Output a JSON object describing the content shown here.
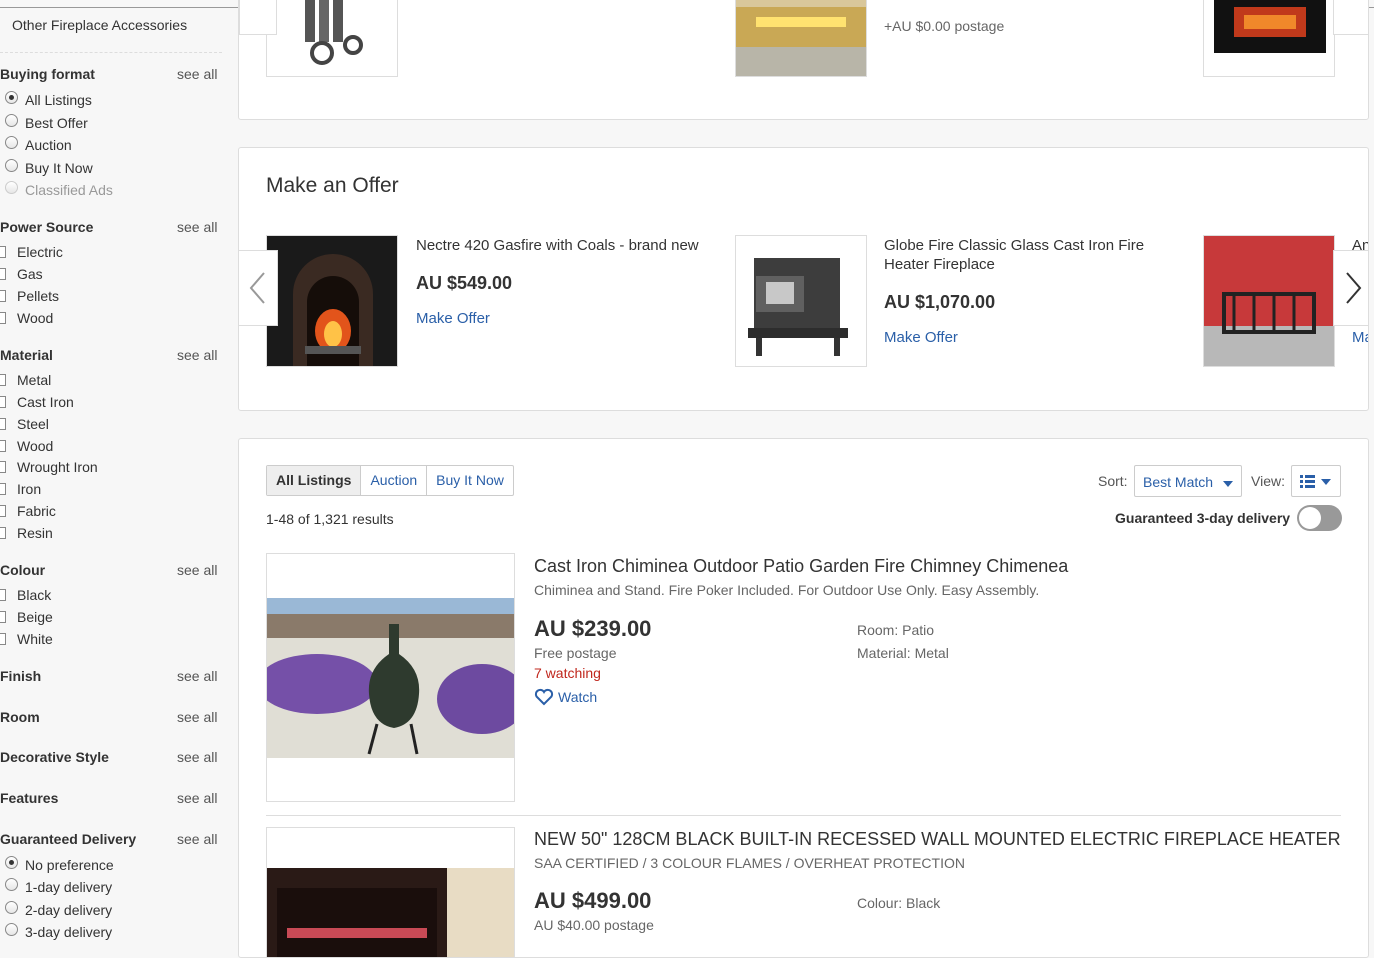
{
  "sidebar": {
    "top_item": "Other Fireplace Accessories",
    "see_all": "see all",
    "buying_format": {
      "heading": "Buying format",
      "options": [
        "All Listings",
        "Best Offer",
        "Auction",
        "Buy It Now",
        "Classified Ads"
      ]
    },
    "power_source": {
      "heading": "Power Source",
      "options": [
        "Electric",
        "Gas",
        "Pellets",
        "Wood"
      ]
    },
    "material": {
      "heading": "Material",
      "options": [
        "Metal",
        "Cast Iron",
        "Steel",
        "Wood",
        "Wrought Iron",
        "Iron",
        "Fabric",
        "Resin"
      ]
    },
    "colour": {
      "heading": "Colour",
      "options": [
        "Black",
        "Beige",
        "White"
      ]
    },
    "finish": {
      "heading": "Finish"
    },
    "room": {
      "heading": "Room"
    },
    "decorative_style": {
      "heading": "Decorative Style"
    },
    "features": {
      "heading": "Features"
    },
    "guaranteed_delivery": {
      "heading": "Guaranteed Delivery",
      "options": [
        "No preference",
        "1-day delivery",
        "2-day delivery",
        "3-day delivery"
      ]
    }
  },
  "top_carousel": {
    "postage": "+AU $0.00 postage"
  },
  "make_offer": {
    "title": "Make an Offer",
    "cards": [
      {
        "title": "Nectre 420 Gasfire with Coals - brand new",
        "price": "AU $549.00",
        "link": "Make Offer"
      },
      {
        "title": "Globe Fire Classic Glass Cast Iron Fire Heater Fireplace",
        "price": "AU $1,070.00",
        "link": "Make Offer"
      },
      {
        "title": "An",
        "link": "Ma"
      }
    ]
  },
  "listings": {
    "tabs": [
      "All Listings",
      "Auction",
      "Buy It Now"
    ],
    "results": "1-48 of 1,321 results",
    "sort_label": "Sort:",
    "sort_value": "Best Match",
    "view_label": "View:",
    "guaranteed_label": "Guaranteed 3-day delivery",
    "items": [
      {
        "title": "Cast Iron Chiminea Outdoor Patio Garden Fire Chimney Chimenea",
        "subtitle": "Chiminea and Stand. Fire Poker Included. For Outdoor Use Only. Easy Assembly.",
        "price": "AU $239.00",
        "shipping": "Free postage",
        "watching": "7 watching",
        "watch": "Watch",
        "attrs": [
          "Room: Patio",
          "Material: Metal"
        ]
      },
      {
        "title": "NEW 50\" 128CM BLACK BUILT-IN RECESSED WALL MOUNTED ELECTRIC FIREPLACE HEATER",
        "subtitle": "SAA CERTIFIED / 3 COLOUR FLAMES / OVERHEAT PROTECTION",
        "price": "AU $499.00",
        "shipping": "AU $40.00 postage",
        "attrs": [
          "Colour: Black"
        ]
      }
    ]
  },
  "colors": {
    "link": "#2a5fa8",
    "watching": "#c0271d",
    "text": "#333333"
  }
}
